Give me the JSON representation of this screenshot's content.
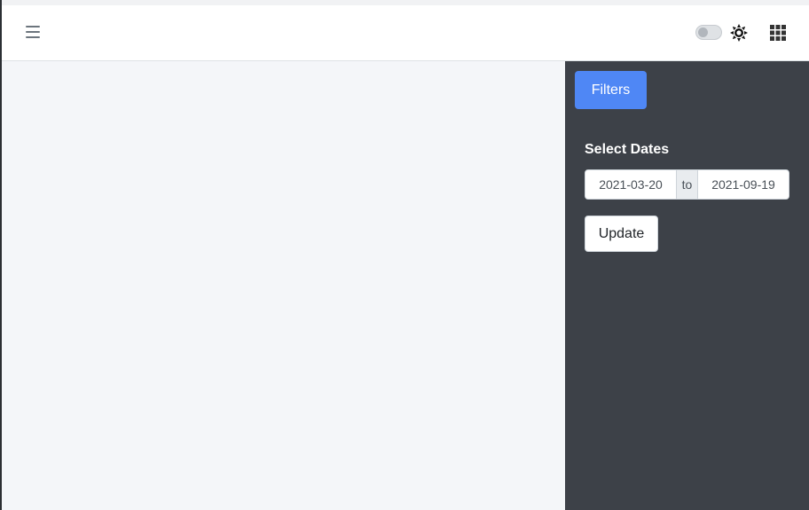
{
  "navbar": {
    "menu_icon": "hamburger-icon",
    "theme_toggle_on": false,
    "theme_icon": "sun-icon",
    "apps_icon": "grid-icon"
  },
  "sidebar": {
    "filters_label": "Filters",
    "dates_label": "Select Dates",
    "start_date": "2021-03-20",
    "separator": "to",
    "end_date": "2021-09-19",
    "update_label": "Update"
  },
  "colors": {
    "accent": "#4f87f5",
    "sidebar_bg": "#3d4148",
    "main_bg": "#f4f6f9"
  }
}
